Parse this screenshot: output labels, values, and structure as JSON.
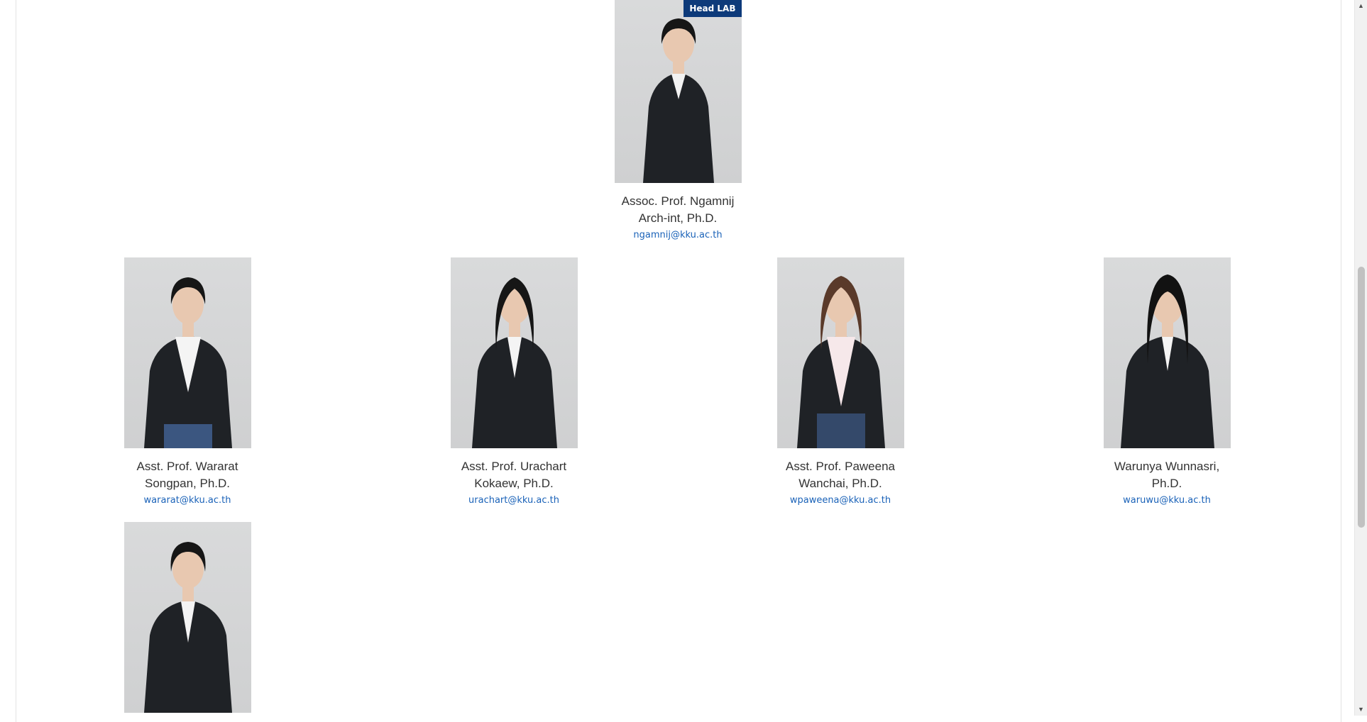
{
  "head": {
    "badge": "Head LAB",
    "name": "Assoc. Prof. Ngamnij Arch-int, Ph.D.",
    "email": "ngamnij@kku.ac.th"
  },
  "members": [
    {
      "name": "Asst. Prof. Wararat Songpan, Ph.D.",
      "email": "wararat@kku.ac.th"
    },
    {
      "name": "Asst. Prof. Urachart Kokaew, Ph.D.",
      "email": "urachart@kku.ac.th"
    },
    {
      "name": "Asst. Prof. Paweena Wanchai, Ph.D.",
      "email": "wpaweena@kku.ac.th"
    },
    {
      "name": "Warunya Wunnasri, Ph.D.",
      "email": "waruwu@kku.ac.th"
    }
  ],
  "scrollbar": {
    "up_icon": "arrow-up-icon",
    "down_icon": "arrow-down-icon",
    "up_glyph": "▲",
    "down_glyph": "▼"
  },
  "colors": {
    "badge": "#0d3a7a",
    "email": "#1a62b8",
    "name": "#333333"
  }
}
